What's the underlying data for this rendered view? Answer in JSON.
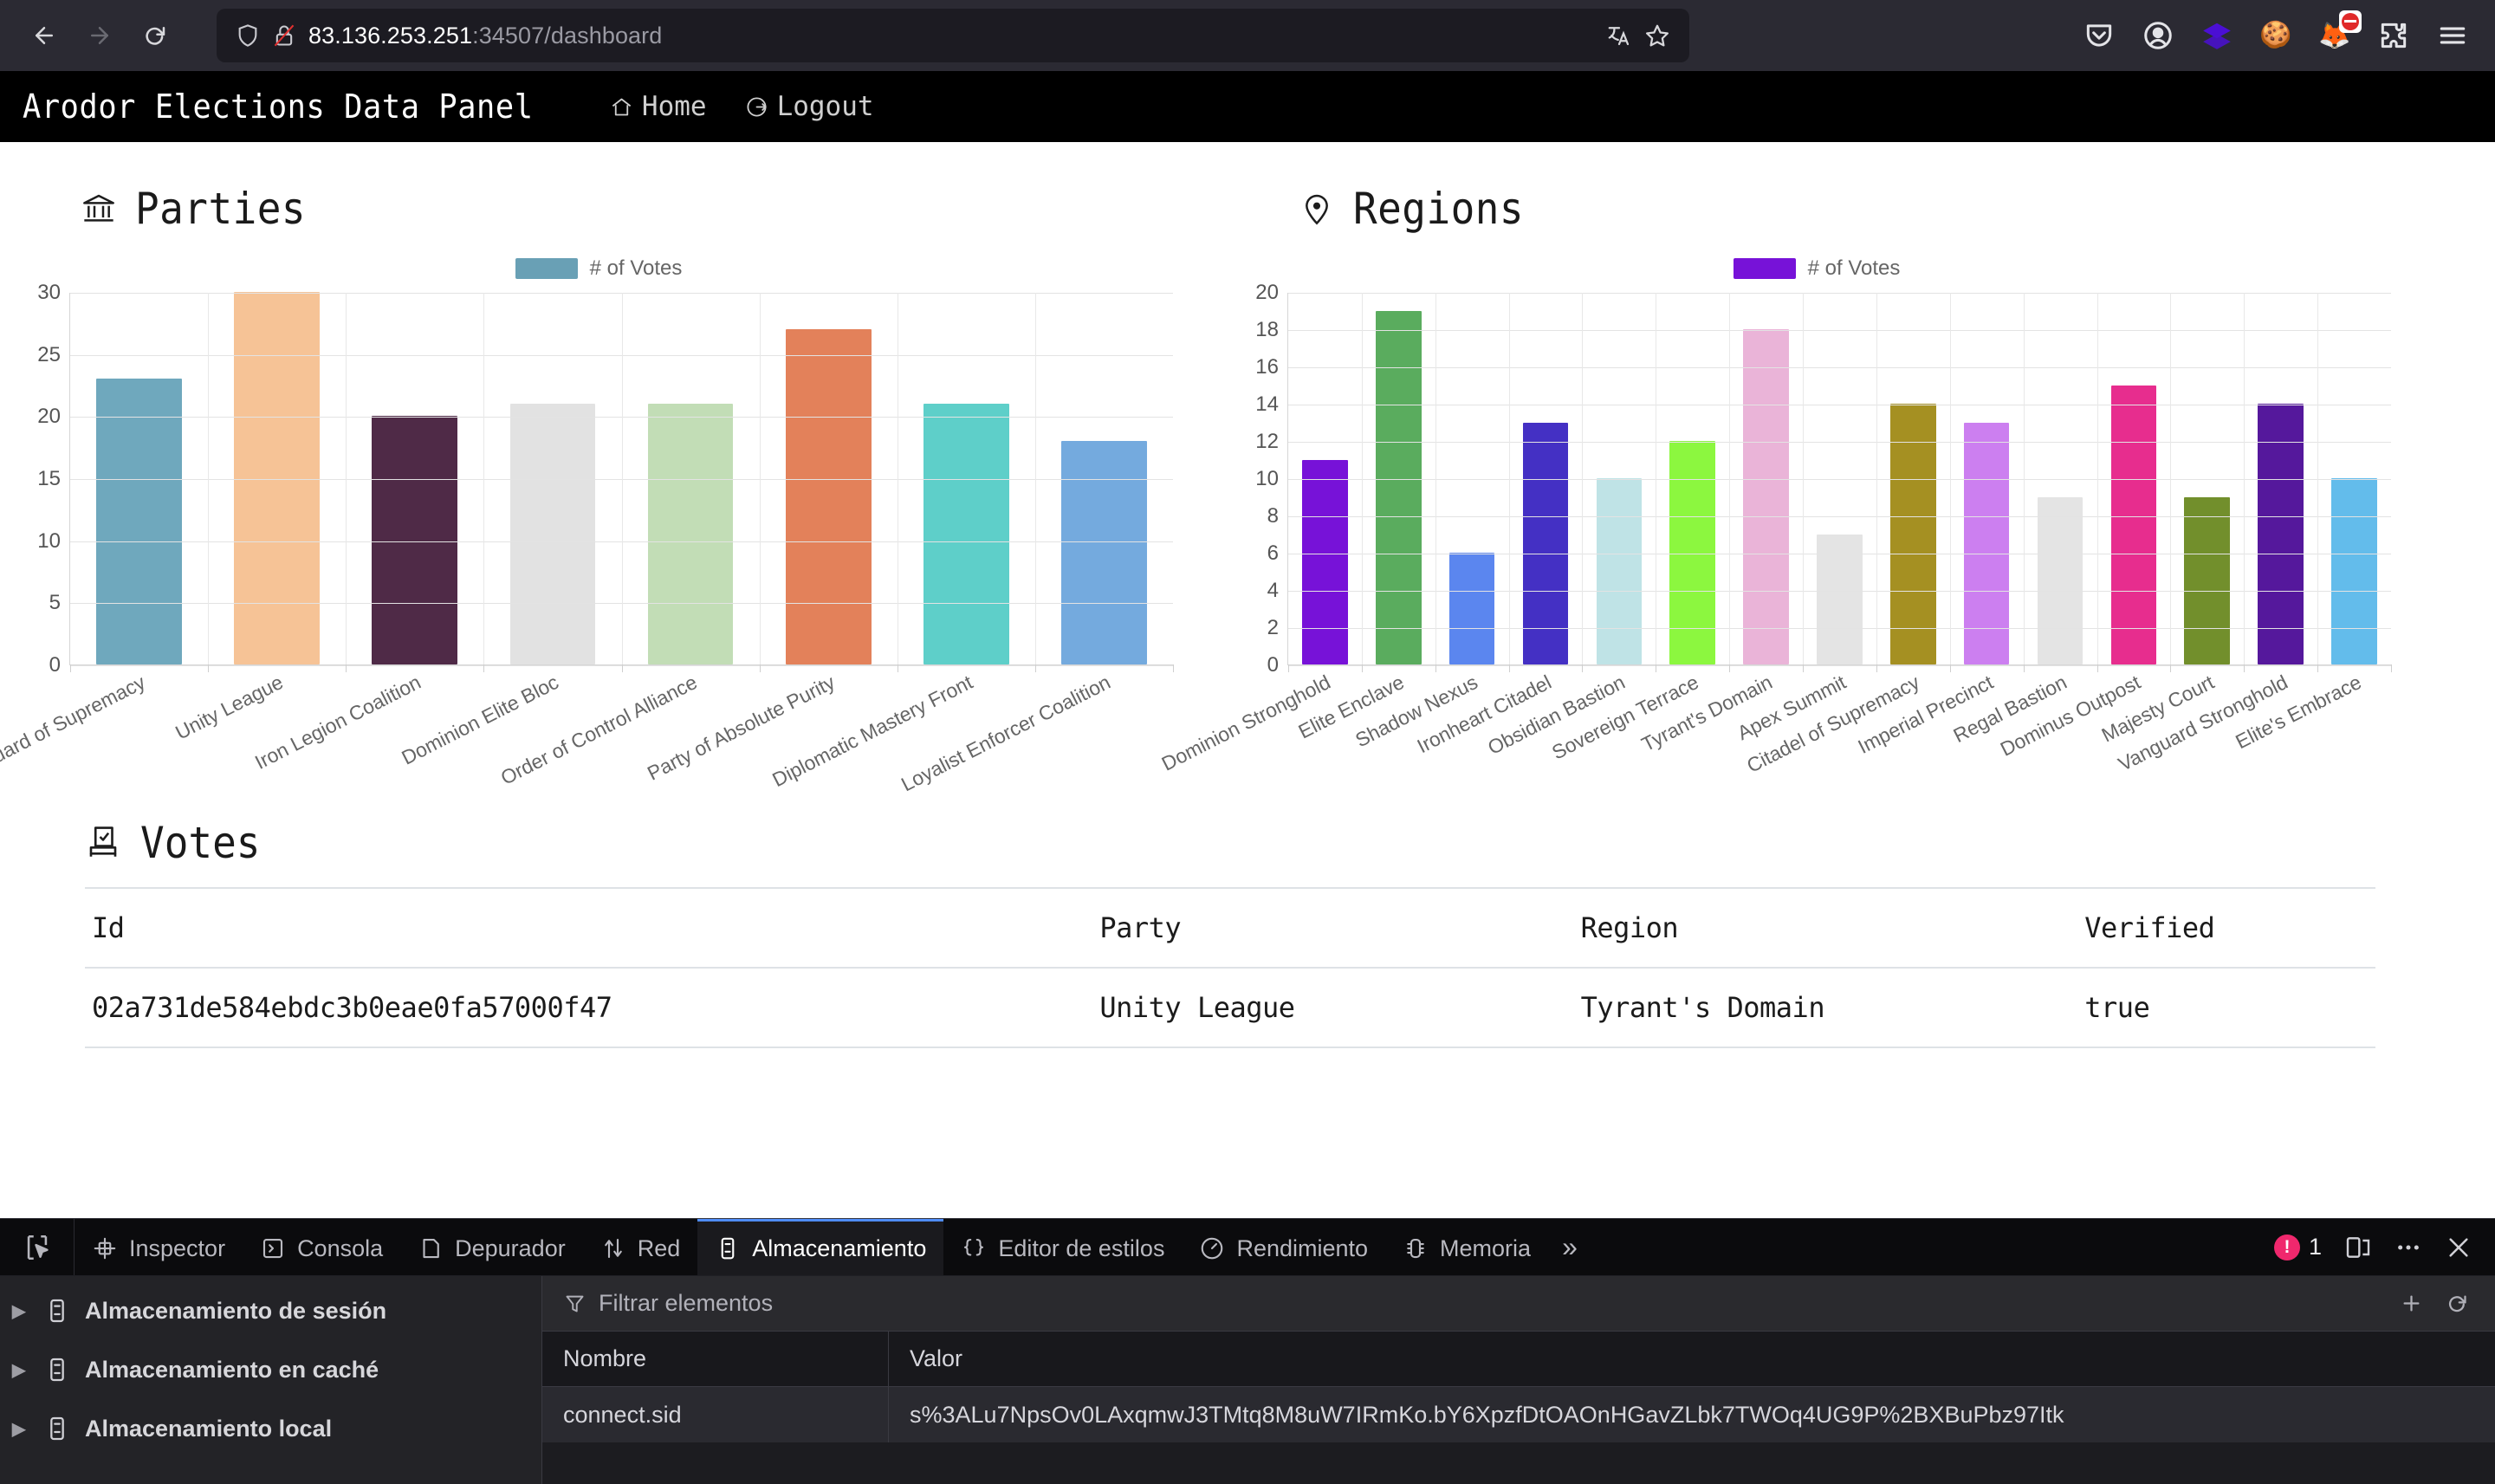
{
  "browser": {
    "url_host": "83.136.253.251",
    "url_rest": ":34507/dashboard",
    "back_icon": "back-arrow-icon",
    "forward_icon": "forward-arrow-icon",
    "reload_icon": "reload-icon",
    "shield_icon": "shield-icon",
    "lock_icon": "lock-disabled-icon",
    "translate_icon": "translate-icon",
    "bookmark_icon": "star-icon",
    "toolbar_icons": [
      "pocket-icon",
      "account-icon",
      "diamond-stack-icon",
      "cookie-icon",
      "extension-blocked-icon",
      "extensions-puzzle-icon",
      "app-menu-icon"
    ]
  },
  "app": {
    "title": "Arodor Elections Data Panel",
    "nav": [
      {
        "label": "Home",
        "icon": "home-icon"
      },
      {
        "label": "Logout",
        "icon": "logout-icon"
      }
    ]
  },
  "parties_section": {
    "title": "Parties",
    "icon": "bank-icon"
  },
  "regions_section": {
    "title": "Regions",
    "icon": "map-pin-icon"
  },
  "votes_section": {
    "title": "Votes",
    "icon": "ballot-box-icon",
    "columns": [
      "Id",
      "Party",
      "Region",
      "Verified"
    ],
    "rows": [
      {
        "id": "02a731de584ebdc3b0eae0fa57000f47",
        "party": "Unity League",
        "region": "Tyrant's Domain",
        "verified": "true"
      }
    ]
  },
  "chart_data": [
    {
      "type": "bar",
      "title": "Parties",
      "legend": [
        "# of Votes"
      ],
      "legend_position": "top-center",
      "legend_color": "#69a0b5",
      "xlabel": "",
      "ylabel": "",
      "ylim": [
        0,
        30
      ],
      "yticks": [
        0,
        5,
        10,
        15,
        20,
        25,
        30
      ],
      "grid": true,
      "categories": [
        "Vanguard of Supremacy",
        "Unity League",
        "Iron Legion Coalition",
        "Dominion Elite Bloc",
        "Order of Control Alliance",
        "Party of Absolute Purity",
        "Diplomatic Mastery Front",
        "Loyalist Enforcer Coalition"
      ],
      "values": [
        23,
        30,
        20,
        21,
        21,
        27,
        21,
        18
      ],
      "colors": [
        "#6fa8bd",
        "#f6c396",
        "#4f2a47",
        "#e2e2e2",
        "#c2ddb6",
        "#e3815a",
        "#5ecfc9",
        "#74aade"
      ]
    },
    {
      "type": "bar",
      "title": "Regions",
      "legend": [
        "# of Votes"
      ],
      "legend_position": "top-center",
      "legend_color": "#7712d8",
      "xlabel": "",
      "ylabel": "",
      "ylim": [
        0,
        20
      ],
      "yticks": [
        0,
        2,
        4,
        6,
        8,
        10,
        12,
        14,
        16,
        18,
        20
      ],
      "grid": true,
      "categories": [
        "Dominion Stronghold",
        "Elite Enclave",
        "Shadow Nexus",
        "Ironheart Citadel",
        "Obsidian Bastion",
        "Sovereign Terrace",
        "Tyrant's Domain",
        "Apex Summit",
        "Citadel of Supremacy",
        "Imperial Precinct",
        "Regal Bastion",
        "Dominus Outpost",
        "Majesty Court",
        "Vanguard Stronghold",
        "Elite's Embrace"
      ],
      "values": [
        11,
        19,
        6,
        13,
        10,
        12,
        18,
        7,
        14,
        13,
        9,
        15,
        9,
        14,
        10
      ],
      "colors": [
        "#7712d8",
        "#5aac5e",
        "#5b86ef",
        "#4430c4",
        "#bfe3e6",
        "#8cf73f",
        "#eab4d8",
        "#e4e4e4",
        "#a59022",
        "#cc7ff0",
        "#e4e4e4",
        "#e72d8e",
        "#728f2c",
        "#55189c",
        "#63bceb"
      ]
    }
  ],
  "devtools": {
    "picker_icon": "element-picker-icon",
    "tabs": [
      {
        "label": "Inspector",
        "icon": "inspector-icon",
        "active": false
      },
      {
        "label": "Consola",
        "icon": "console-icon",
        "active": false
      },
      {
        "label": "Depurador",
        "icon": "debugger-icon",
        "active": false
      },
      {
        "label": "Red",
        "icon": "network-icon",
        "active": false
      },
      {
        "label": "Almacenamiento",
        "icon": "storage-icon",
        "active": true
      },
      {
        "label": "Editor de estilos",
        "icon": "style-editor-icon",
        "active": false
      },
      {
        "label": "Rendimiento",
        "icon": "performance-icon",
        "active": false
      },
      {
        "label": "Memoria",
        "icon": "memory-icon",
        "active": false
      }
    ],
    "overflow_label": "»",
    "error_count": "1",
    "dock_icon": "dock-layout-icon",
    "more_icon": "more-options-icon",
    "close_icon": "close-icon",
    "storage_tree": [
      {
        "label": "Almacenamiento de sesión",
        "icon": "storage-item-icon"
      },
      {
        "label": "Almacenamiento en caché",
        "icon": "storage-item-icon"
      },
      {
        "label": "Almacenamiento local",
        "icon": "storage-item-icon"
      }
    ],
    "filter_placeholder": "Filtrar elementos",
    "filter_icon": "filter-icon",
    "add_icon": "add-item-icon",
    "refresh_icon": "refresh-icon",
    "table_columns": [
      "Nombre",
      "Valor"
    ],
    "table_rows": [
      {
        "name": "connect.sid",
        "value": "s%3ALu7NpsOv0LAxqmwJ3TMtq8M8uW7IRmKo.bY6XpzfDtOAOnHGavZLbk7TWOq4UG9P%2BXBuPbz97Itk"
      }
    ]
  }
}
